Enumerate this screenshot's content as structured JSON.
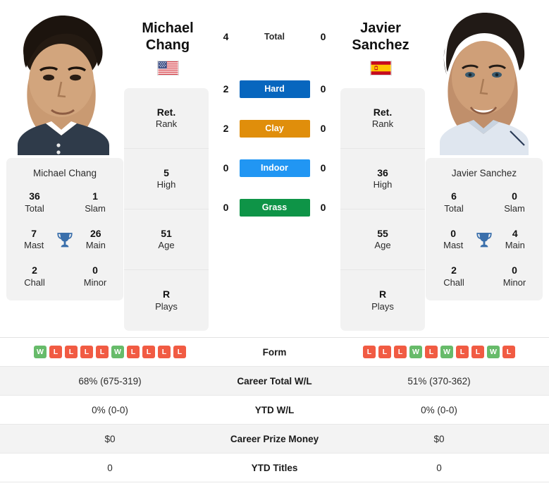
{
  "players": {
    "left": {
      "first_name": "Michael",
      "last_name": "Chang",
      "full_name": "Michael Chang",
      "country": "USA",
      "flag_icon": "flag-usa-icon",
      "titles": {
        "total_value": "36",
        "total_label": "Total",
        "slam_value": "1",
        "slam_label": "Slam",
        "mast_value": "7",
        "mast_label": "Mast",
        "main_value": "26",
        "main_label": "Main",
        "chall_value": "2",
        "chall_label": "Chall",
        "minor_value": "0",
        "minor_label": "Minor",
        "trophy_icon": "trophy-icon"
      },
      "ranking": [
        {
          "value": "Ret.",
          "label": "Rank"
        },
        {
          "value": "5",
          "label": "High"
        },
        {
          "value": "51",
          "label": "Age"
        },
        {
          "value": "R",
          "label": "Plays"
        }
      ],
      "form": [
        "W",
        "L",
        "L",
        "L",
        "L",
        "W",
        "L",
        "L",
        "L",
        "L"
      ],
      "career_total_wl": "68% (675-319)",
      "ytd_wl": "0% (0-0)",
      "career_prize_money": "$0",
      "ytd_titles": "0"
    },
    "right": {
      "first_name": "Javier",
      "last_name": "Sanchez",
      "full_name": "Javier Sanchez",
      "country": "ESP",
      "flag_icon": "flag-spain-icon",
      "titles": {
        "total_value": "6",
        "total_label": "Total",
        "slam_value": "0",
        "slam_label": "Slam",
        "mast_value": "0",
        "mast_label": "Mast",
        "main_value": "4",
        "main_label": "Main",
        "chall_value": "2",
        "chall_label": "Chall",
        "minor_value": "0",
        "minor_label": "Minor",
        "trophy_icon": "trophy-icon"
      },
      "ranking": [
        {
          "value": "Ret.",
          "label": "Rank"
        },
        {
          "value": "36",
          "label": "High"
        },
        {
          "value": "55",
          "label": "Age"
        },
        {
          "value": "R",
          "label": "Plays"
        }
      ],
      "form": [
        "L",
        "L",
        "L",
        "W",
        "L",
        "W",
        "L",
        "L",
        "W",
        "L"
      ],
      "career_total_wl": "51% (370-362)",
      "ytd_wl": "0% (0-0)",
      "career_prize_money": "$0",
      "ytd_titles": "0"
    }
  },
  "head_to_head": {
    "total": {
      "label": "Total",
      "left": "4",
      "right": "0"
    },
    "surfaces": [
      {
        "label": "Hard",
        "left": "2",
        "right": "0",
        "color": "#0766be"
      },
      {
        "label": "Clay",
        "left": "2",
        "right": "0",
        "color": "#e08e0b"
      },
      {
        "label": "Indoor",
        "left": "0",
        "right": "0",
        "color": "#2196f3"
      },
      {
        "label": "Grass",
        "left": "0",
        "right": "0",
        "color": "#0e9447"
      }
    ]
  },
  "stat_rows": {
    "form_label": "Form",
    "career_total_wl_label": "Career Total W/L",
    "ytd_wl_label": "YTD W/L",
    "career_prize_money_label": "Career Prize Money",
    "ytd_titles_label": "YTD Titles"
  },
  "colors": {
    "win": "#67bb6a",
    "loss": "#f15b43",
    "card_bg": "#f2f2f2",
    "row_shade": "#f3f3f3"
  }
}
